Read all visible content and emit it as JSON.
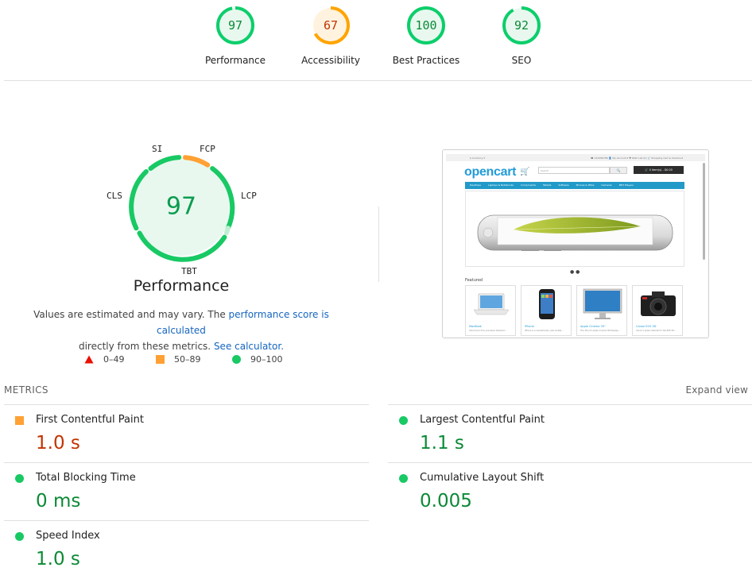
{
  "gauges": [
    {
      "score": "97",
      "label": "Performance",
      "value": 0.97,
      "rating": "pass"
    },
    {
      "score": "67",
      "label": "Accessibility",
      "value": 0.67,
      "rating": "average"
    },
    {
      "score": "100",
      "label": "Best Practices",
      "value": 1.0,
      "rating": "pass"
    },
    {
      "score": "92",
      "label": "SEO",
      "value": 0.92,
      "rating": "pass"
    }
  ],
  "performance": {
    "score": "97",
    "title": "Performance",
    "metric_tags": {
      "si": "SI",
      "fcp": "FCP",
      "lcp": "LCP",
      "tbt": "TBT",
      "cls": "CLS"
    },
    "description_1": "Values are estimated and may vary. The ",
    "description_link_1": "performance score is calculated",
    "description_2": "directly from these metrics. ",
    "description_link_2": "See calculator."
  },
  "legend": {
    "fail": "0–49",
    "average": "50–89",
    "pass": "90–100"
  },
  "colors": {
    "pass": "#0cce6b",
    "pass_text": "#0b8a36",
    "average": "#ffa400",
    "average_text": "#c33300",
    "fail": "#ff4e42",
    "link": "#1565c0"
  },
  "thumbnail": {
    "topbar_left": "$ Currency ▾",
    "topbar_right": "☎ 123456789   👤 My Account ▾   ♥ Wish List (0)   🛒 Shopping Cart   ➦ Checkout",
    "logo": "opencart",
    "search_placeholder": "Search",
    "search_button": "🔍",
    "cart_button": "🛒 0 item(s) - $0.00",
    "menu": [
      "Desktops",
      "Laptops & Notebooks",
      "Components",
      "Tablets",
      "Software",
      "Phones & PDAs",
      "Cameras",
      "MP3 Players"
    ],
    "featured_label": "Featured",
    "products": [
      {
        "name": "MacBook",
        "desc": "Intel Core 2 Duo processor Powered..."
      },
      {
        "name": "iPhone",
        "desc": "iPhone is a revolutionary new mobile..."
      },
      {
        "name": "Apple Cinema 30\"",
        "desc": "The 30-inch Apple Cinema HD Display..."
      },
      {
        "name": "Canon EOS 5D",
        "desc": "Canon's press material for the EOS 5D..."
      }
    ]
  },
  "metrics": {
    "title": "METRICS",
    "expand_label": "Expand view",
    "items": [
      {
        "name": "First Contentful Paint",
        "value": "1.0 s",
        "rating": "average"
      },
      {
        "name": "Largest Contentful Paint",
        "value": "1.1 s",
        "rating": "pass"
      },
      {
        "name": "Total Blocking Time",
        "value": "0 ms",
        "rating": "pass"
      },
      {
        "name": "Cumulative Layout Shift",
        "value": "0.005",
        "rating": "pass"
      },
      {
        "name": "Speed Index",
        "value": "1.0 s",
        "rating": "pass"
      }
    ]
  }
}
